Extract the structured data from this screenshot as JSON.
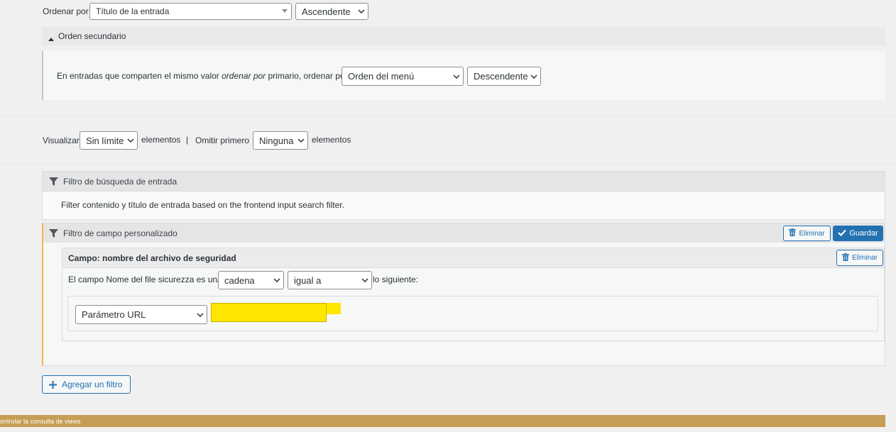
{
  "sort": {
    "label": "Ordenar por",
    "field_value": "Título de la entrada",
    "order_value": "Ascendente"
  },
  "secondary_sort": {
    "toggle_label": "Orden secundario",
    "text_before": "En entradas que comparten el mismo valor ",
    "text_italic": "ordenar por",
    "text_after": " primario, ordenar por",
    "field_value": "Orden del menú",
    "order_value": "Descendente"
  },
  "limits": {
    "show_label": "Visualizar",
    "show_value": "Sin límite",
    "items_label_1": "elementos",
    "separator": "|",
    "skip_label": "Omitir primero",
    "skip_value": "Ninguna",
    "items_label_2": "elementos"
  },
  "search_filter": {
    "title": "Filtro de búsqueda de entrada",
    "description": "Filter contenido y título de entrada based on the frontend input search filter."
  },
  "custom_field_filter": {
    "title": "Filtro de campo personalizado",
    "delete_label": "Eliminar",
    "save_label": "Guardar",
    "field_title": "Campo: nombre del archivo de seguridad",
    "field_delete_label": "Eliminar",
    "condition_before": "El campo Nome del file sicurezza es un/a",
    "type_value": "cadena",
    "comparison_value": "igual a",
    "condition_after": "lo siguiente:",
    "source_value": "Parámetro URL",
    "param_value": ""
  },
  "add_filter_label": "Agregar un filtro",
  "footer_bar_text": "ontrolar la consulta de views",
  "colors": {
    "accent": "#2271b1",
    "highlight": "#ffe600",
    "footer_bar": "#c59d55"
  }
}
